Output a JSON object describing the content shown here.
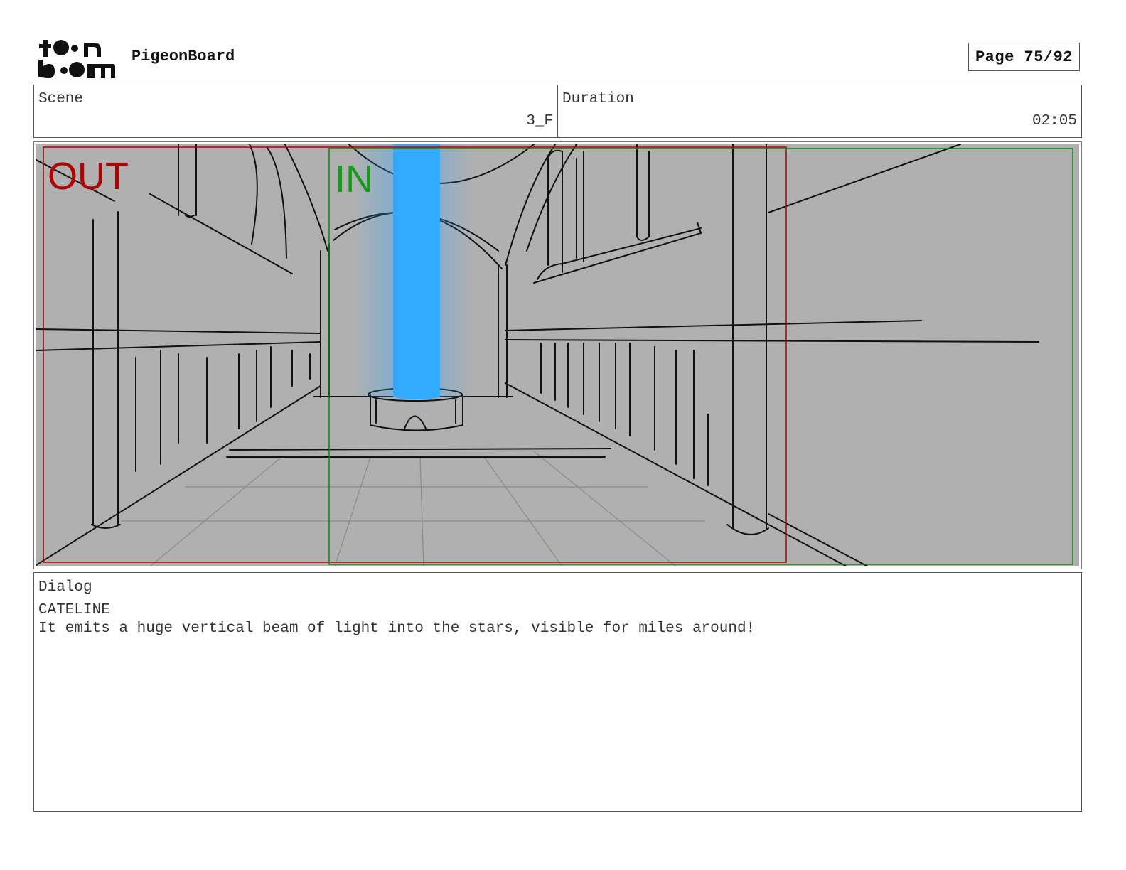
{
  "header": {
    "logo_text": "toon boom",
    "app_title": "PigeonBoard",
    "page_label": "Page 75/92"
  },
  "scene": {
    "label": "Scene",
    "value": "3_F"
  },
  "duration": {
    "label": "Duration",
    "value": "02:05"
  },
  "panel": {
    "out_label": "OUT",
    "in_label": "IN",
    "colors": {
      "out": "#b00000",
      "in": "#1a9a1a",
      "beam": "#33aaff",
      "background": "#b0b0b0"
    }
  },
  "dialog": {
    "label": "Dialog",
    "speaker": "CATELINE",
    "line": "It emits a huge vertical beam of light into the stars, visible for miles around!"
  }
}
